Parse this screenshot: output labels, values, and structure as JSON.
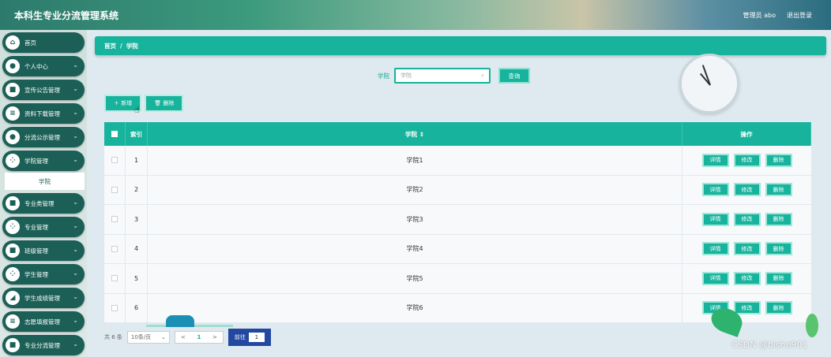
{
  "header": {
    "app_title": "本科生专业分流管理系统",
    "user_label": "管理员 abo",
    "logout_label": "退出登录"
  },
  "sidebar": {
    "items": [
      {
        "label": "首页",
        "icon": "home-icon",
        "glyph": "⌂",
        "has_children": false
      },
      {
        "label": "个人中心",
        "icon": "user-icon",
        "glyph": "●",
        "has_children": true
      },
      {
        "label": "宣传公告管理",
        "icon": "notice-icon",
        "glyph": "■",
        "has_children": true
      },
      {
        "label": "资料下载管理",
        "icon": "settings-icon",
        "glyph": "≡",
        "has_children": true
      },
      {
        "label": "分流公示管理",
        "icon": "user-icon",
        "glyph": "●",
        "has_children": true
      },
      {
        "label": "学院管理",
        "icon": "grid-icon",
        "glyph": "⁘",
        "has_children": true,
        "expanded": true
      },
      {
        "label": "专业类管理",
        "icon": "list-icon",
        "glyph": "■",
        "has_children": true
      },
      {
        "label": "专业管理",
        "icon": "grid-icon",
        "glyph": "⁘",
        "has_children": true
      },
      {
        "label": "班级管理",
        "icon": "document-icon",
        "glyph": "■",
        "has_children": true
      },
      {
        "label": "学生管理",
        "icon": "grid-icon",
        "glyph": "⁘",
        "has_children": true
      },
      {
        "label": "学生成绩管理",
        "icon": "chart-icon",
        "glyph": "◢",
        "has_children": true
      },
      {
        "label": "志愿填报管理",
        "icon": "list-icon",
        "glyph": "≡",
        "has_children": true
      },
      {
        "label": "专业分流管理",
        "icon": "list-icon",
        "glyph": "■",
        "has_children": true
      }
    ],
    "active_subitem": "学院"
  },
  "breadcrumb": {
    "home": "首页",
    "separator": "/",
    "current": "学院"
  },
  "search": {
    "label": "学院",
    "placeholder": "学院",
    "button_label": "查询"
  },
  "actions": {
    "add_label": "＋ 新增",
    "delete_label": "🗑 删除"
  },
  "table": {
    "headers": {
      "index": "索引",
      "name": "学院 ⇕",
      "ops": "操作"
    },
    "rows": [
      {
        "index": "1",
        "name": "学院1"
      },
      {
        "index": "2",
        "name": "学院2"
      },
      {
        "index": "3",
        "name": "学院3"
      },
      {
        "index": "4",
        "name": "学院4"
      },
      {
        "index": "5",
        "name": "学院5"
      },
      {
        "index": "6",
        "name": "学院6"
      }
    ],
    "row_actions": {
      "detail": "详情",
      "edit": "修改",
      "delete": "删除"
    }
  },
  "pagination": {
    "total_text": "共 6 条",
    "page_size": "10条/页",
    "prev": "<",
    "current_page": "1",
    "next": ">",
    "jump_label": "前往",
    "jump_value": "1"
  },
  "watermark": "CSDN @bishe901",
  "colors": {
    "accent": "#17b39c",
    "sidebar_item": "#1b5f56"
  }
}
